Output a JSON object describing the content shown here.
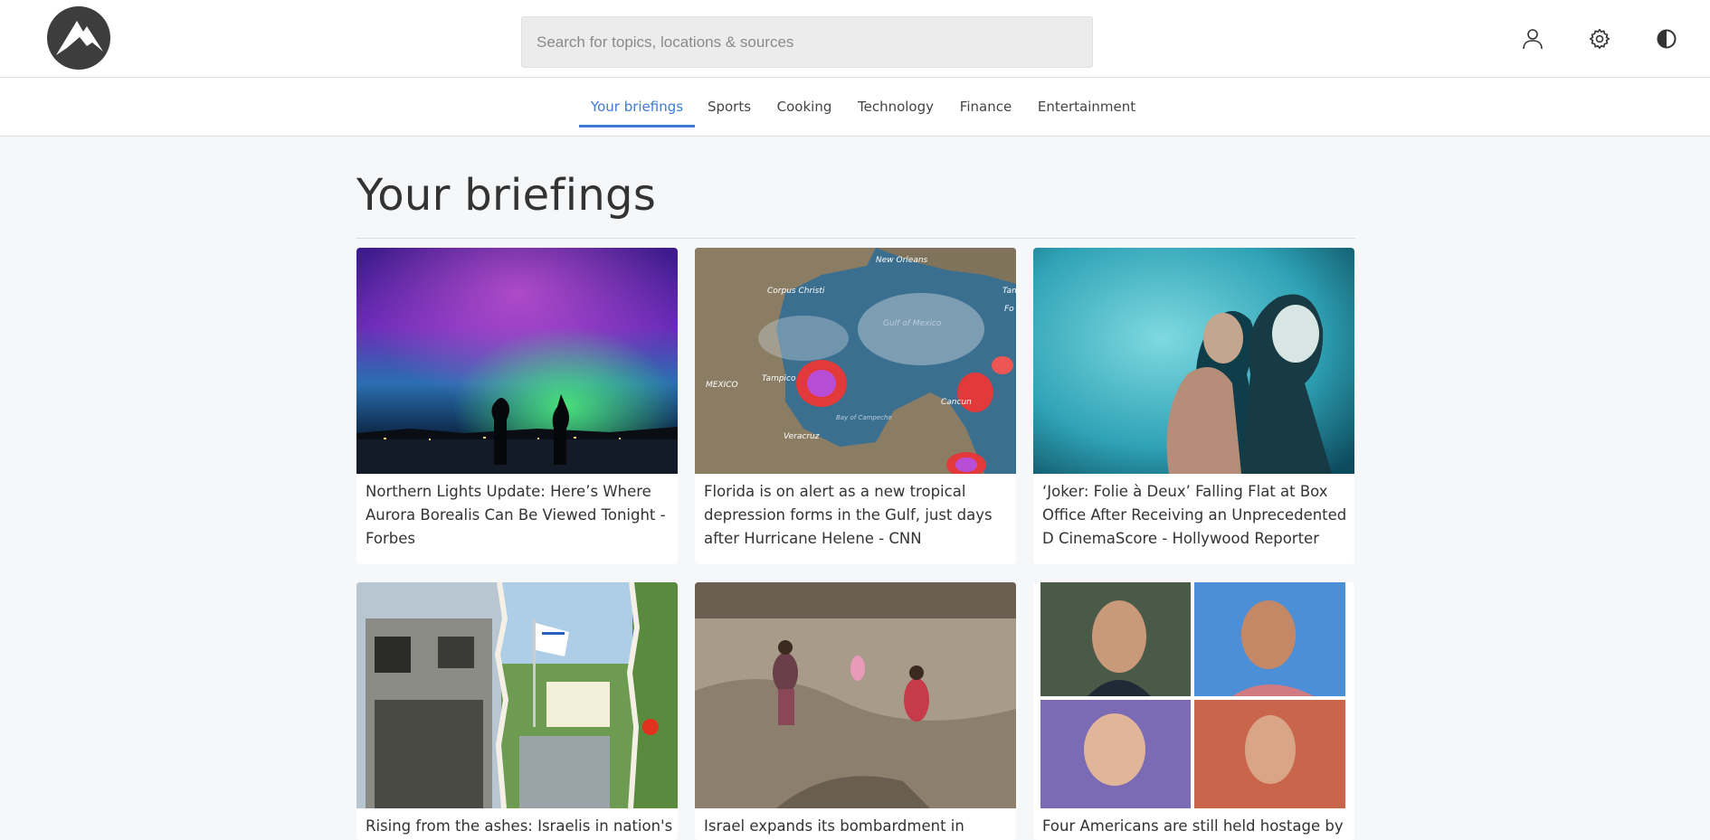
{
  "header": {
    "logo_label": "",
    "search": {
      "placeholder": "Search for topics, locations & sources",
      "value": ""
    },
    "icons": [
      "user-icon",
      "settings-gear-icon",
      "contrast-icon"
    ]
  },
  "nav": {
    "tabs": [
      {
        "label": "Your briefings",
        "active": true
      },
      {
        "label": "Sports",
        "active": false
      },
      {
        "label": "Cooking",
        "active": false
      },
      {
        "label": "Technology",
        "active": false
      },
      {
        "label": "Finance",
        "active": false
      },
      {
        "label": "Entertainment",
        "active": false
      }
    ]
  },
  "main": {
    "title": "Your briefings",
    "cards": [
      {
        "caption": "Northern Lights Update: Here’s Where Aurora Borealis Can Be Viewed Tonight - Forbes",
        "image": "aurora-photo"
      },
      {
        "caption": "Florida is on alert as a new tropical depression forms in the Gulf, just days after Hurricane Helene - CNN",
        "image": "weather-radar-map",
        "map_labels": [
          "New Orleans",
          "Corpus Christi",
          "Gulf of Mexico",
          "MEXICO",
          "Tampico",
          "Cancun",
          "Veracruz",
          "Bay of Campeche",
          "Tam",
          "Fo"
        ]
      },
      {
        "caption": "‘Joker: Folie à Deux’ Falling Flat at Box Office After Receiving an Unprecedented D CinemaScore - Hollywood Reporter",
        "image": "joker-film-still"
      },
      {
        "caption": "Rising from the ashes: Israelis in nation's",
        "image": "burned-house-collage"
      },
      {
        "caption": "Israel expands its bombardment in",
        "image": "rubble-children-photo"
      },
      {
        "caption": "Four Americans are still held hostage by",
        "image": "hostage-portraits-grid"
      }
    ]
  },
  "colors": {
    "accent": "#3d7ad6",
    "background": "#f6f7f9",
    "header_bg": "#ffffff",
    "search_bg": "#ececec"
  }
}
